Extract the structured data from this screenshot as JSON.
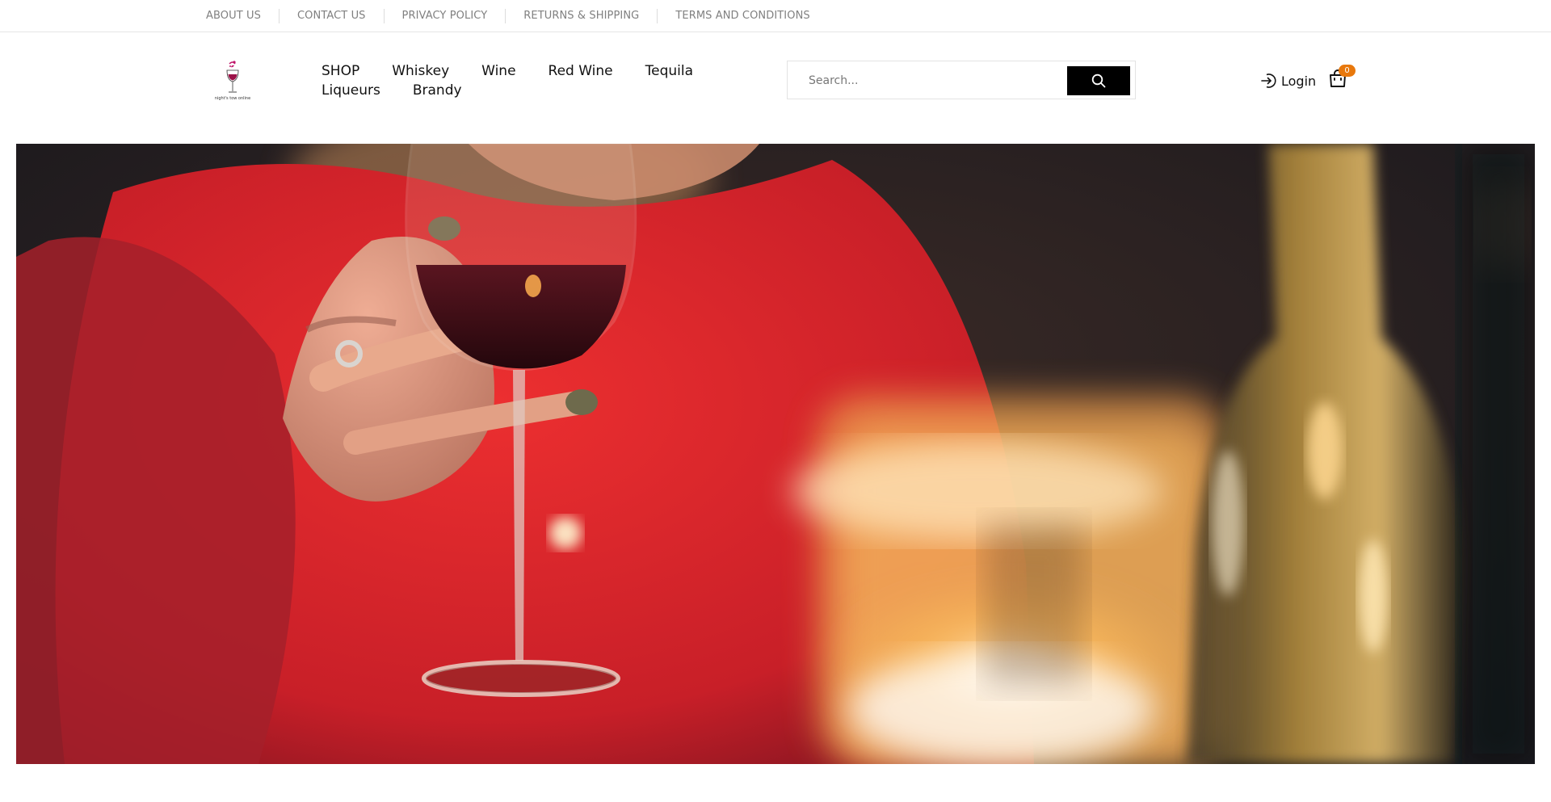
{
  "topbar": {
    "links": [
      "ABOUT US",
      "CONTACT US",
      "PRIVACY POLICY",
      "RETURNS & SHIPPING",
      "TERMS AND CONDITIONS"
    ]
  },
  "header": {
    "logo": {
      "text": "night's tow online",
      "icon": "wine-glass-splash-logo"
    },
    "nav": {
      "row1": [
        "SHOP",
        "Whiskey",
        "Wine",
        "Red Wine",
        "Tequila"
      ],
      "row2": [
        "Liqueurs",
        "Brandy"
      ]
    },
    "search": {
      "placeholder": "Search...",
      "value": "",
      "icon": "search-icon"
    },
    "login": {
      "label": "Login",
      "icon": "login-icon"
    },
    "cart": {
      "count": "0",
      "icon": "shopping-bag-icon"
    }
  },
  "hero": {
    "image": "woman-holding-red-wine-glass-candlelight",
    "colors": {
      "sweater": "#d8262b",
      "wine": "#3a0e14",
      "candle": "#f6a64a",
      "background": "#14161c"
    }
  },
  "colors": {
    "accent": "#e8780c",
    "button": "#000000",
    "muted_text": "#808080"
  }
}
